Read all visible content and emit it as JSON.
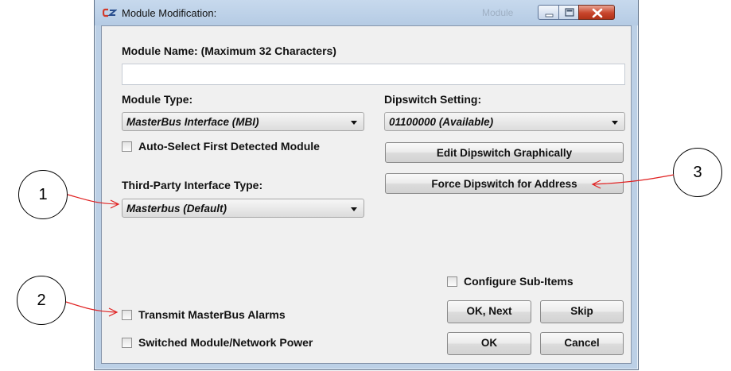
{
  "window": {
    "title": "Module Modification:",
    "background_title": "Module",
    "controls": {
      "minimize": "minimize-icon",
      "maximize": "maximize-icon",
      "close": "close-icon"
    }
  },
  "module_name": {
    "label": "Module Name: (Maximum 32 Characters)",
    "value": ""
  },
  "module_type": {
    "label": "Module Type:",
    "selected": "MasterBus Interface (MBI)"
  },
  "auto_select": {
    "label": "Auto-Select First Detected Module",
    "checked": false
  },
  "dipswitch": {
    "label": "Dipswitch Setting:",
    "selected": "01100000 (Available)",
    "edit_button": "Edit Dipswitch Graphically",
    "force_button": "Force Dipswitch for Address"
  },
  "third_party": {
    "label": "Third-Party Interface Type:",
    "selected": "Masterbus (Default)"
  },
  "configure_sub_items": {
    "label": "Configure Sub-Items",
    "checked": false
  },
  "transmit_alarms": {
    "label": "Transmit MasterBus Alarms",
    "checked": false
  },
  "switched_power": {
    "label": "Switched Module/Network Power",
    "checked": false
  },
  "buttons": {
    "ok_next": "OK, Next",
    "skip": "Skip",
    "ok": "OK",
    "cancel": "Cancel"
  },
  "callouts": [
    "1",
    "2",
    "3"
  ],
  "colors": {
    "frame": "#bcd0e6",
    "client": "#f0f0f0",
    "close_button": "#c8452c",
    "arrow": "#e02020"
  }
}
